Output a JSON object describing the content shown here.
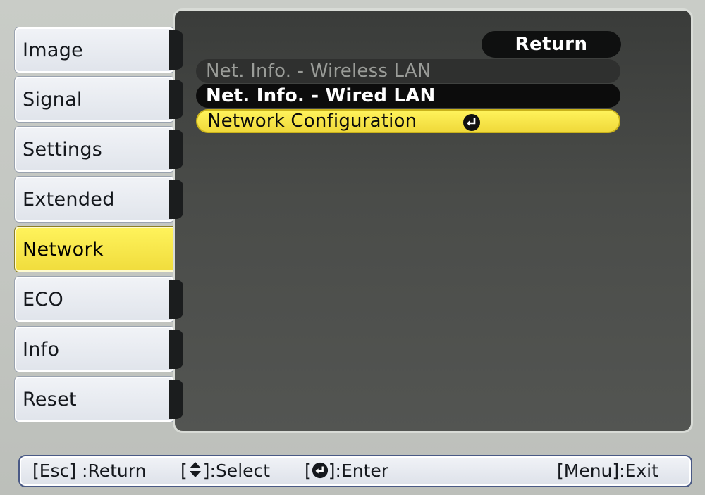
{
  "menu": {
    "tabs": [
      {
        "label": "Image"
      },
      {
        "label": "Signal"
      },
      {
        "label": "Settings"
      },
      {
        "label": "Extended"
      },
      {
        "label": "Network",
        "active": true
      },
      {
        "label": "ECO"
      },
      {
        "label": "Info"
      },
      {
        "label": "Reset"
      }
    ]
  },
  "panel": {
    "return_label": "Return",
    "items": [
      {
        "label": "Net. Info. - Wireless LAN",
        "state": "disabled"
      },
      {
        "label": "Net. Info. - Wired LAN",
        "state": "normal"
      },
      {
        "label": "Network Configuration",
        "state": "selected",
        "icon": "enter-icon"
      }
    ]
  },
  "footer": {
    "esc_key": "[Esc]",
    "esc_action": ":Return",
    "select_open": "[",
    "select_icon": "up-down-arrow-icon",
    "select_close": "]:Select",
    "enter_open": "[",
    "enter_icon": "enter-icon",
    "enter_close": "]:Enter",
    "menu_key": "[Menu]",
    "menu_action": ":Exit"
  },
  "colors": {
    "highlight": "#f3dd3e",
    "panel": "#474946",
    "tab": "#e6e9ef",
    "text": "#15181d"
  }
}
